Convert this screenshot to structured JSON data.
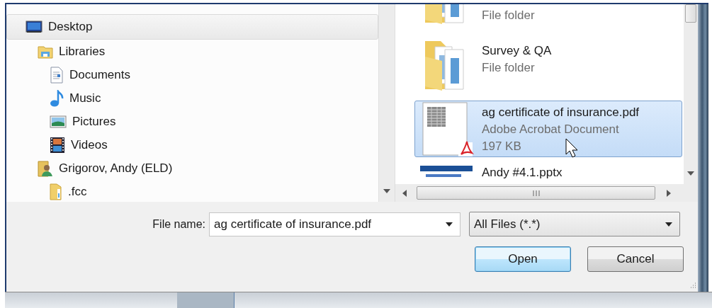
{
  "nav_tree": {
    "items": [
      {
        "label": "Desktop",
        "kind": "desktop",
        "selected": true,
        "children": [
          {
            "label": "Libraries",
            "kind": "library",
            "selected": false,
            "children": [
              {
                "label": "Documents",
                "kind": "documents",
                "selected": false
              },
              {
                "label": "Music",
                "kind": "music",
                "selected": false
              },
              {
                "label": "Pictures",
                "kind": "pictures",
                "selected": false
              },
              {
                "label": "Videos",
                "kind": "videos",
                "selected": false
              }
            ]
          },
          {
            "label": "Grigorov, Andy (ELD)",
            "kind": "user-folder",
            "selected": false,
            "children": [
              {
                "label": ".fcc",
                "kind": "folder",
                "selected": false
              }
            ]
          }
        ]
      }
    ]
  },
  "files": {
    "items": [
      {
        "kind": "folder",
        "type": "File folder",
        "selected": false
      },
      {
        "kind": "folder",
        "name": "Survey & QA",
        "type": "File folder",
        "selected": false
      },
      {
        "kind": "pdf",
        "name": "ag certificate of insurance.pdf",
        "type": "Adobe Acrobat Document",
        "size": "197 KB",
        "selected": true
      },
      {
        "kind": "slides",
        "name": "Andy #4.1.pptx",
        "selected": false
      }
    ]
  },
  "file_name": {
    "label": "File name:",
    "value": "ag certificate of insurance.pdf"
  },
  "file_type": {
    "value": "All Files (*.*)"
  },
  "buttons": [
    {
      "label": "Open",
      "default": true
    },
    {
      "label": "Cancel",
      "default": false
    }
  ]
}
